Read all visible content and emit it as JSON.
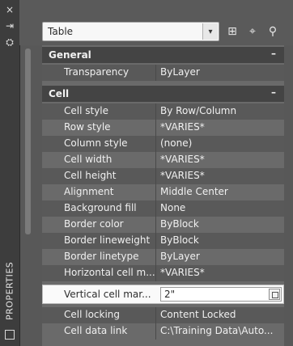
{
  "left_toolbar": {
    "close_icon": "close-icon",
    "pin_icon": "auto-hide-icon",
    "settings_icon": "properties-icon",
    "vertical_title": "PROPERTIES",
    "bottom_icon": "panel-icon"
  },
  "object_selector": {
    "value": "Table"
  },
  "toolbar": {
    "add_icon": "add-to-selection-icon",
    "pick_icon": "pick-object-icon",
    "quick_select_icon": "quick-select-icon"
  },
  "sections": [
    {
      "title": "General",
      "toggle": "–",
      "rows": [
        {
          "label": "Transparency",
          "value": "ByLayer"
        }
      ]
    },
    {
      "title": "Cell",
      "toggle": "–",
      "rows": [
        {
          "label": "Cell style",
          "value": "By Row/Column"
        },
        {
          "label": "Row style",
          "value": "*VARIES*"
        },
        {
          "label": "Column style",
          "value": "(none)"
        },
        {
          "label": "Cell width",
          "value": "*VARIES*"
        },
        {
          "label": "Cell height",
          "value": "*VARIES*"
        },
        {
          "label": "Alignment",
          "value": "Middle Center"
        },
        {
          "label": "Background fill",
          "value": " None"
        },
        {
          "label": "Border color",
          "value": "ByBlock"
        },
        {
          "label": "Border lineweight",
          "value": "ByBlock"
        },
        {
          "label": "Border linetype",
          "value": "ByLayer"
        },
        {
          "label": "Horizontal cell m...",
          "value": "*VARIES*"
        }
      ]
    }
  ],
  "active_row": {
    "label": "Vertical cell mar...",
    "value": "2\"",
    "picker_icon": "calculator-icon"
  },
  "after_rows": [
    {
      "label": "Cell locking",
      "value": "Content Locked"
    },
    {
      "label": "Cell data link",
      "value": "C:\\Training  Data\\Auto..."
    }
  ]
}
